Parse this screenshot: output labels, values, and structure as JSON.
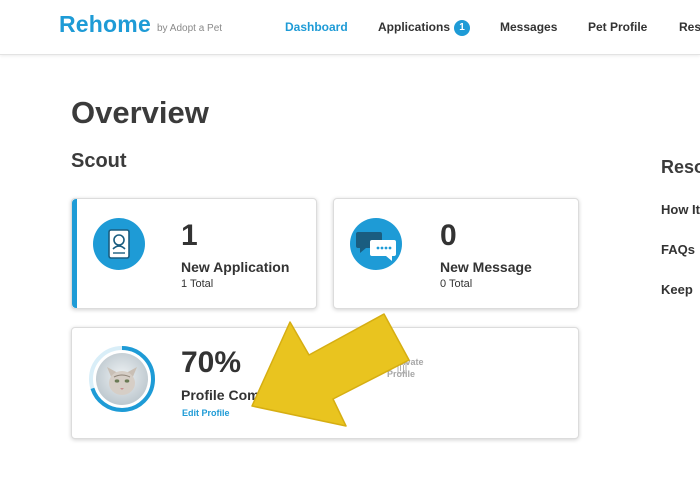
{
  "header": {
    "logo": "Rehome",
    "logo_sub": "by Adopt a Pet",
    "nav": [
      {
        "label": "Dashboard"
      },
      {
        "label": "Applications",
        "badge": "1"
      },
      {
        "label": "Messages"
      },
      {
        "label": "Pet Profile"
      },
      {
        "label": "Res"
      }
    ]
  },
  "main": {
    "title": "Overview",
    "pet_name": "Scout",
    "cards": {
      "applications": {
        "count": "1",
        "label": "New Application",
        "sub": "1 Total",
        "icon": "application-document-icon"
      },
      "messages": {
        "count": "0",
        "label": "New Message",
        "sub": "0 Total",
        "icon": "chat-bubbles-icon"
      },
      "profile": {
        "percent": "70%",
        "progress": 0.7,
        "label": "Profile Comp",
        "edit_link": "Edit Profile",
        "avatar": "cat-photo"
      },
      "deactivate": {
        "line1": "Deactivate",
        "line2": "Profile",
        "icon": "trash-icon"
      }
    }
  },
  "resources": {
    "title": "Reso",
    "links": [
      "How It",
      "FAQs",
      "Keep "
    ]
  },
  "annotation": {
    "icon": "yellow-arrow-icon",
    "color": "#e9c41f"
  },
  "colors": {
    "accent": "#1e9bd6",
    "text": "#333333"
  }
}
